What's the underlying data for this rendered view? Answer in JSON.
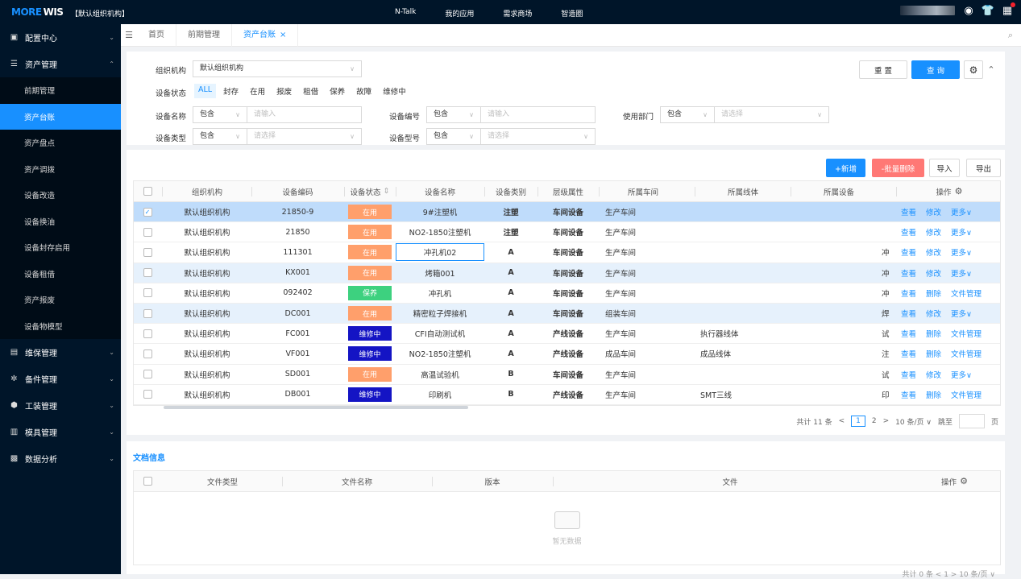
{
  "topbar": {
    "logo": "MORE",
    "logo_suffix": "WIS",
    "org": "【默认组织机构】",
    "nav": [
      "N-Talk",
      "我的应用",
      "需求商场",
      "智造圈"
    ]
  },
  "sidebar": {
    "groups": [
      {
        "label": "配置中心",
        "icon": "config-icon"
      },
      {
        "label": "资产管理",
        "icon": "list-icon",
        "expanded": true,
        "items": [
          "前期管理",
          "资产台账",
          "资产盘点",
          "资产调拨",
          "设备改造",
          "设备换油",
          "设备封存启用",
          "设备租借",
          "资产报废",
          "设备物模型"
        ],
        "active": "资产台账"
      },
      {
        "label": "维保管理",
        "icon": "calendar-icon"
      },
      {
        "label": "备件管理",
        "icon": "gear-icon"
      },
      {
        "label": "工装管理",
        "icon": "tool-icon"
      },
      {
        "label": "模具管理",
        "icon": "mold-icon"
      },
      {
        "label": "数据分析",
        "icon": "chart-icon"
      }
    ]
  },
  "tabs": {
    "items": [
      "首页",
      "前期管理",
      "资产台账"
    ],
    "active": "资产台账",
    "close": "×"
  },
  "filter": {
    "org_label": "组织机构",
    "org_value": "默认组织机构",
    "status_label": "设备状态",
    "status_options": [
      "ALL",
      "封存",
      "在用",
      "报废",
      "租借",
      "保养",
      "故障",
      "维修中"
    ],
    "status_active": "ALL",
    "name_label": "设备名称",
    "code_label": "设备编号",
    "dept_label": "使用部门",
    "type_label": "设备类型",
    "model_label": "设备型号",
    "contains": "包含",
    "input_ph": "请输入",
    "select_ph": "请选择",
    "reset": "重 置",
    "search": "查 询"
  },
  "toolbar": {
    "add": "+新增",
    "batch_delete": "-批量删除",
    "import": "导入",
    "export": "导出"
  },
  "table": {
    "headers": [
      "组织机构",
      "设备编码",
      "设备状态",
      "设备名称",
      "设备类别",
      "层级属性",
      "所属车间",
      "所属线体",
      "所属设备",
      "操作"
    ],
    "sort_icon": "⇕",
    "rows": [
      {
        "org": "默认组织机构",
        "code": "21850-9",
        "status": "在用",
        "name": "9#注塑机",
        "category": "注塑",
        "level": "车间设备",
        "workshop": "生产车间",
        "line": "",
        "device": "",
        "actions": [
          "查看",
          "修改",
          "更多∨"
        ]
      },
      {
        "org": "默认组织机构",
        "code": "21850",
        "status": "在用",
        "name": "NO2-1850注塑机",
        "category": "注塑",
        "level": "车间设备",
        "workshop": "生产车间",
        "line": "",
        "device": "",
        "actions": [
          "查看",
          "修改",
          "更多∨"
        ]
      },
      {
        "org": "默认组织机构",
        "code": "111301",
        "status": "在用",
        "name": "冲孔机02",
        "category": "A",
        "level": "车间设备",
        "workshop": "生产车间",
        "line": "",
        "device": "冲",
        "actions": [
          "查看",
          "修改",
          "更多∨"
        ]
      },
      {
        "org": "默认组织机构",
        "code": "KX001",
        "status": "在用",
        "name": "烤箱001",
        "category": "A",
        "level": "车间设备",
        "workshop": "生产车间",
        "line": "",
        "device": "冲",
        "actions": [
          "查看",
          "修改",
          "更多∨"
        ]
      },
      {
        "org": "默认组织机构",
        "code": "092402",
        "status": "保养",
        "name": "冲孔机",
        "category": "A",
        "level": "车间设备",
        "workshop": "生产车间",
        "line": "",
        "device": "冲",
        "actions": [
          "查看",
          "删除",
          "文件管理"
        ]
      },
      {
        "org": "默认组织机构",
        "code": "DC001",
        "status": "在用",
        "name": "精密粒子焊接机",
        "category": "A",
        "level": "车间设备",
        "workshop": "组装车间",
        "line": "",
        "device": "焊",
        "actions": [
          "查看",
          "修改",
          "更多∨"
        ]
      },
      {
        "org": "默认组织机构",
        "code": "FC001",
        "status": "维修中",
        "name": "CFI自动测试机",
        "category": "A",
        "level": "产线设备",
        "workshop": "生产车间",
        "line": "执行器线体",
        "device": "试",
        "actions": [
          "查看",
          "删除",
          "文件管理"
        ]
      },
      {
        "org": "默认组织机构",
        "code": "VF001",
        "status": "维修中",
        "name": "NO2-1850注塑机",
        "category": "A",
        "level": "产线设备",
        "workshop": "成品车间",
        "line": "成品线体",
        "device": "注",
        "actions": [
          "查看",
          "删除",
          "文件管理"
        ]
      },
      {
        "org": "默认组织机构",
        "code": "SD001",
        "status": "在用",
        "name": "高温试验机",
        "category": "B",
        "level": "车间设备",
        "workshop": "生产车间",
        "line": "",
        "device": "试",
        "actions": [
          "查看",
          "修改",
          "更多∨"
        ]
      },
      {
        "org": "默认组织机构",
        "code": "DB001",
        "status": "维修中",
        "name": "印刷机",
        "category": "B",
        "level": "产线设备",
        "workshop": "生产车间",
        "line": "SMT三线",
        "device": "印",
        "actions": [
          "查看",
          "删除",
          "文件管理"
        ]
      }
    ]
  },
  "pager": {
    "total": "共计 11 条",
    "prev": "<",
    "pages": [
      "1",
      "2"
    ],
    "next": ">",
    "size": "10 条/页 ∨",
    "jump": "跳至",
    "page_unit": "页"
  },
  "docs": {
    "title": "文档信息",
    "headers": [
      "文件类型",
      "文件名称",
      "版本",
      "文件",
      "操作"
    ],
    "empty": "暂无数据",
    "pager": "共计 0 条   <   1   >   10 条/页 ∨"
  }
}
